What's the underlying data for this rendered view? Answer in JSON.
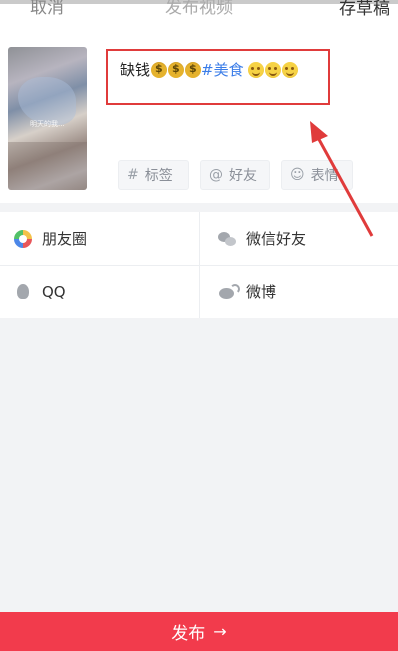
{
  "header": {
    "cancel_label": "取消",
    "title": "发布视频",
    "draft_label": "存草稿"
  },
  "composer": {
    "thumbnail_text": "明天的我...",
    "caption": {
      "text": "缺钱",
      "money_emoji_count": 3,
      "hashtag": "#美食",
      "smile_emoji_count": 3
    },
    "chips": {
      "tag_icon": "#",
      "tag_label": "标签",
      "friend_icon": "@",
      "friend_label": "好友",
      "emoji_icon": "☺",
      "emoji_label": "表情"
    },
    "highlight_color": "#e03b3b"
  },
  "share": {
    "moments": "朋友圈",
    "wechat": "微信好友",
    "qq": "QQ",
    "weibo": "微博"
  },
  "publish": {
    "label": "发布",
    "arrow": "→",
    "color": "#f23b4c"
  }
}
